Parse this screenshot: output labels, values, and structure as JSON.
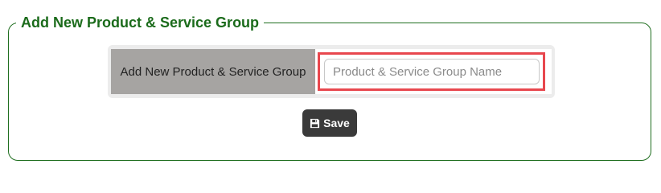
{
  "panel": {
    "legend": "Add New Product & Service Group"
  },
  "form": {
    "field_label": "Add New Product & Service Group",
    "name_input": {
      "value": "",
      "placeholder": "Product & Service Group Name"
    },
    "highlight_color": "#e8474e"
  },
  "actions": {
    "save_label": "Save",
    "save_icon": "floppy-disk-icon"
  },
  "colors": {
    "accent_green": "#1b6b1b",
    "label_cell": "#a6a4a2",
    "button_bg": "#3a3a3a"
  }
}
